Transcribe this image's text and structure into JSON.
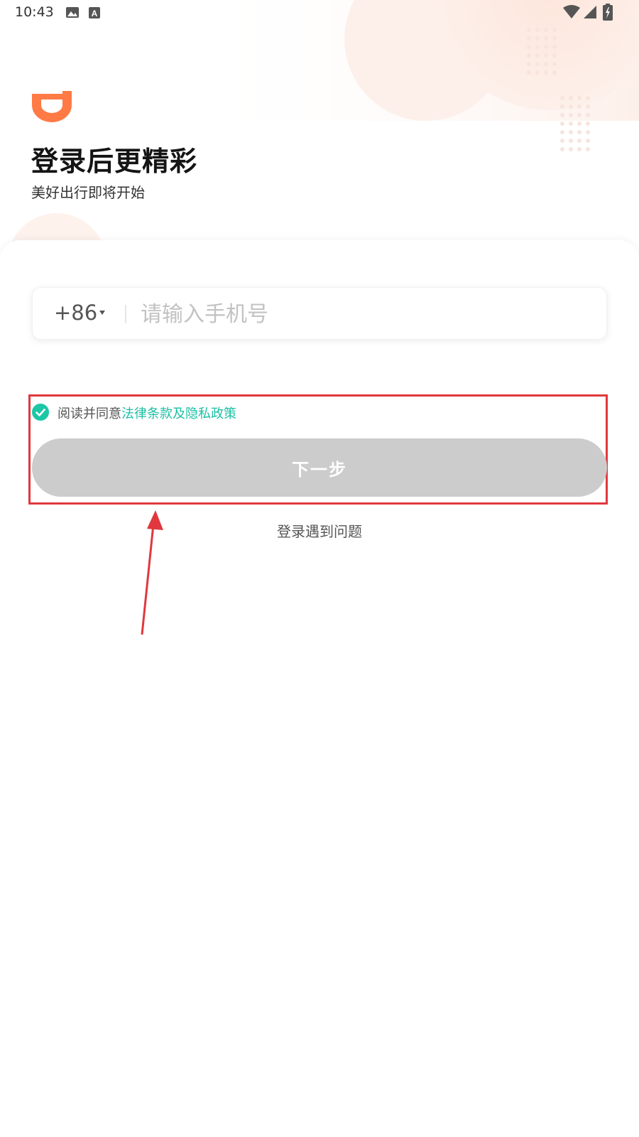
{
  "status_bar": {
    "time": "10:43",
    "icons": [
      "image-icon",
      "keyboard-a-icon",
      "wifi-icon",
      "signal-icon",
      "battery-charging-icon"
    ]
  },
  "header": {
    "title": "登录后更精彩",
    "subtitle": "美好出行即将开始"
  },
  "colors": {
    "brand_orange": "#ff7a45",
    "link_teal": "#1bbfa4",
    "button_disabled": "#cccccc",
    "annotation_red": "#e0383e"
  },
  "form": {
    "country_code": "+86",
    "phone_placeholder": "请输入手机号",
    "phone_value": ""
  },
  "agreement": {
    "checked": true,
    "prefix": "阅读并同意",
    "link": "法律条款及隐私政策"
  },
  "next_button": {
    "label": "下一步",
    "enabled": false
  },
  "help_link": "登录遇到问题"
}
